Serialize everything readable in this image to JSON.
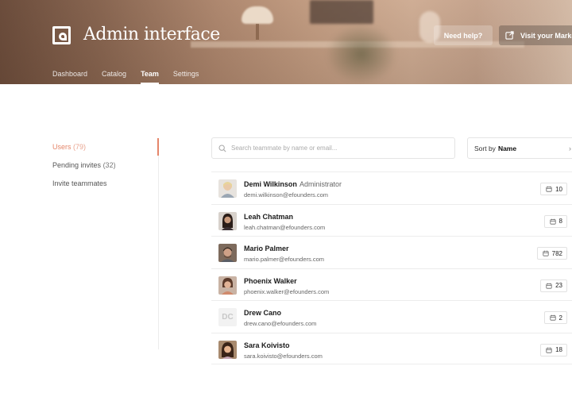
{
  "app": {
    "title": "Admin interface"
  },
  "header": {
    "help_label": "Need help?",
    "visit_label": "Visit your Marke",
    "tabs": [
      {
        "label": "Dashboard",
        "active": false
      },
      {
        "label": "Catalog",
        "active": false
      },
      {
        "label": "Team",
        "active": true
      },
      {
        "label": "Settings",
        "active": false
      }
    ]
  },
  "sidebar": {
    "items": [
      {
        "label": "Users",
        "count": "(79)",
        "active": true
      },
      {
        "label": "Pending invites",
        "count": "(32)",
        "active": false
      },
      {
        "label": "Invite teammates",
        "count": "",
        "active": false
      }
    ]
  },
  "search": {
    "placeholder": "Search teammate by name or email...",
    "value": ""
  },
  "sort": {
    "prefix": "Sort by",
    "value": "Name"
  },
  "users": [
    {
      "name": "Demi Wilkinson",
      "role": "Administrator",
      "email": "demi.wilkinson@efounders.com",
      "count": "10",
      "avatar": "photo"
    },
    {
      "name": "Leah Chatman",
      "role": "",
      "email": "leah.chatman@efounders.com",
      "count": "8",
      "avatar": "photo"
    },
    {
      "name": "Mario Palmer",
      "role": "",
      "email": "mario.palmer@efounders.com",
      "count": "782",
      "avatar": "photo"
    },
    {
      "name": "Phoenix Walker",
      "role": "",
      "email": "phoenix.walker@efounders.com",
      "count": "23",
      "avatar": "photo"
    },
    {
      "name": "Drew Cano",
      "role": "",
      "email": "drew.cano@efounders.com",
      "count": "2",
      "avatar": "DC"
    },
    {
      "name": "Sara Koivisto",
      "role": "",
      "email": "sara.koivisto@efounders.com",
      "count": "18",
      "avatar": "photo"
    }
  ],
  "colors": {
    "accent": "#e5866a",
    "hero": "#b48d74"
  },
  "icons": {
    "logo": "app-logo-icon",
    "external": "external-link-icon",
    "search": "search-icon",
    "badge": "calendar-icon",
    "sort": "chevron-icon"
  }
}
